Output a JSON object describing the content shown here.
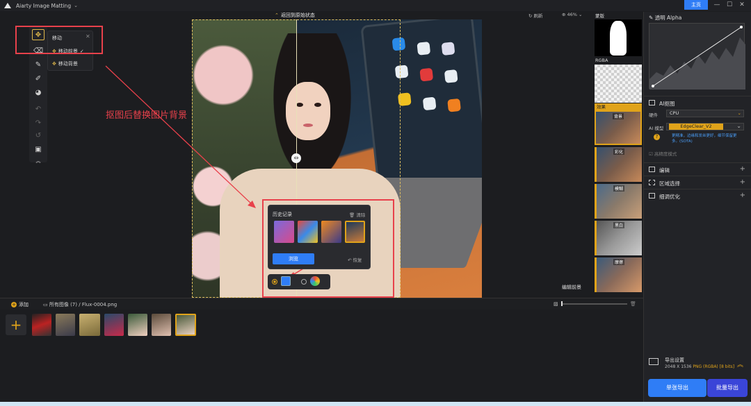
{
  "titlebar": {
    "app_title": "Aiarty Image Matting",
    "home_label": "主页",
    "min": "—",
    "max": "☐",
    "close": "✕"
  },
  "topbar": {
    "back_original": "返回到原始状态",
    "reset": "刷新",
    "zoom": "46%"
  },
  "move_menu": {
    "title": "移动",
    "item1": "移动前景",
    "item2": "移动背景"
  },
  "annotation": {
    "text": "抠图后替换图片背景"
  },
  "history": {
    "title": "历史记录",
    "clear": "清除",
    "browse": "浏览",
    "restore": "恢复"
  },
  "canvas": {
    "edit_fg": "编辑前景"
  },
  "preview": {
    "mask_label": "蒙版",
    "rgba_label": "RGBA",
    "effect_label": "效果",
    "effects": [
      "背景",
      "彩化",
      "模糊",
      "黑白",
      "摩擦"
    ]
  },
  "panel": {
    "alpha_title": "透明 Alpha",
    "ai_title": "AI抠图",
    "device_label": "硬件",
    "device_value": "CPU",
    "model_label": "AI 模型",
    "model_value": "EdgeClear_V2",
    "model_desc": "更精准，边缘和发丝更好，细节保留更多。(SOTA)",
    "compare_label": "高精度模式",
    "sections": [
      "编辑",
      "区域选择",
      "细调优化"
    ],
    "export_title": "导出设置",
    "export_size": "2048 X 1536",
    "export_format": "PNG (RGBA) [8 bits]",
    "single_export": "单张导出",
    "batch_export": "批量导出"
  },
  "filebar": {
    "add": "添加",
    "all_images": "所有图像 (7)",
    "sep": "/",
    "filename": "Flux-0004.png"
  },
  "colors": {
    "accent": "#e0a31a",
    "primary": "#2f7df6",
    "annotation": "#e8414b"
  }
}
